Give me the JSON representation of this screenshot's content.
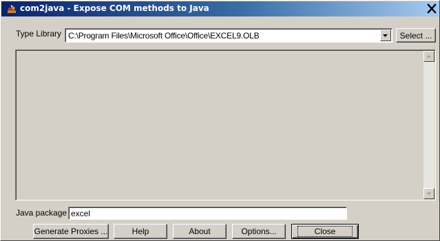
{
  "window": {
    "title": "com2java - Expose COM methods to Java",
    "close_glyph": "×"
  },
  "type_library": {
    "label": "Type Library",
    "value": "C:\\Program Files\\Microsoft Office\\Office\\EXCEL9.OLB",
    "select_button": "Select ..."
  },
  "java_package": {
    "label": "Java package",
    "value": "excel"
  },
  "buttons": {
    "generate": "Generate Proxies ...",
    "help": "Help",
    "about": "About",
    "options": "Options...",
    "close": "Close"
  },
  "icons": {
    "app": "com2java-app-icon",
    "close": "close-icon",
    "dropdown": "chevron-down-icon",
    "scroll_up": "scroll-up-icon",
    "scroll_down": "scroll-down-icon"
  },
  "colors": {
    "titlebar_start": "#0a246a",
    "titlebar_end": "#a6caf0",
    "face": "#d4d0c8"
  }
}
